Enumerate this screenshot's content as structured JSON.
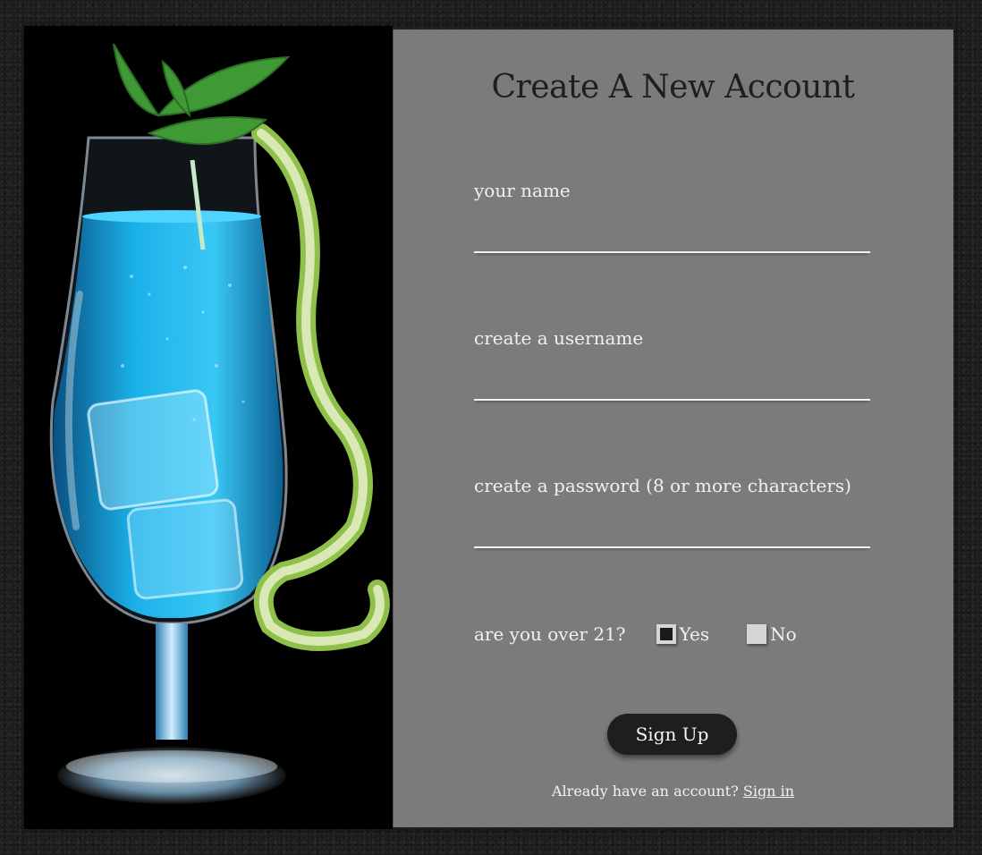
{
  "form": {
    "title": "Create A New Account",
    "fields": [
      {
        "label": "your name",
        "value": ""
      },
      {
        "label": "create a username",
        "value": ""
      },
      {
        "label": "create a password (8 or more characters)",
        "value": ""
      }
    ],
    "age": {
      "question": "are you over 21?",
      "options": [
        {
          "label": "Yes",
          "checked": true
        },
        {
          "label": "No",
          "checked": false
        }
      ]
    },
    "submit_label": "Sign Up",
    "signin_prompt": "Already have an account?",
    "signin_link": "Sign in"
  },
  "colors": {
    "panel": "#7b7b7b",
    "button": "#1e1e1e",
    "drink": "#1ab0e8",
    "lime": "#8ec04a"
  },
  "images": {
    "hero": "blue-cocktail-with-mint-and-lime-peel"
  }
}
